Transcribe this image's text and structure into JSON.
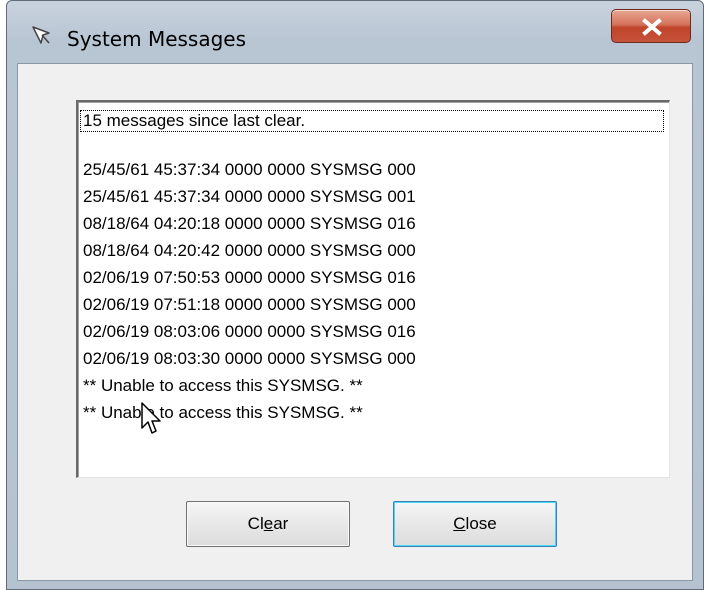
{
  "window": {
    "title": "System Messages"
  },
  "messages": {
    "summary": "15 messages since last clear.",
    "lines": [
      "25/45/61 45:37:34 0000 0000 SYSMSG 000",
      "25/45/61 45:37:34 0000 0000 SYSMSG 001",
      "08/18/64 04:20:18 0000 0000 SYSMSG 016",
      "08/18/64 04:20:42 0000 0000 SYSMSG 000",
      "02/06/19 07:50:53 0000 0000 SYSMSG 016",
      "02/06/19 07:51:18 0000 0000 SYSMSG 000",
      "02/06/19 08:03:06 0000 0000 SYSMSG 016",
      "02/06/19 08:03:30 0000 0000 SYSMSG 000",
      "** Unable to access this SYSMSG. **",
      "** Unable to access this SYSMSG. **"
    ]
  },
  "buttons": {
    "clear_pre": "Cl",
    "clear_accel": "e",
    "clear_post": "ar",
    "close_accel": "C",
    "close_post": "lose"
  },
  "icons": {
    "window_icon": "pushpin-icon",
    "close": "close-icon",
    "cursor": "mouse-pointer-icon"
  },
  "colors": {
    "close_button": "#c4533a",
    "default_button_border": "#3c7fb1"
  }
}
